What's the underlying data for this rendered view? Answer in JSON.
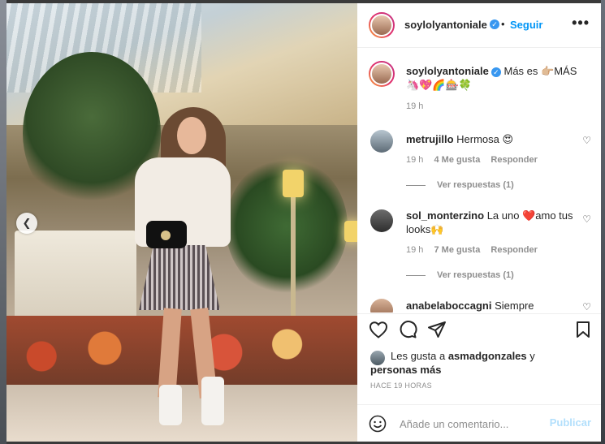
{
  "post": {
    "username": "soylolyantoniale",
    "follow_label": "Seguir",
    "more_icon": "more-options-icon",
    "caption_text": "Más es 👉🏼MÁS",
    "caption_emojis": "🦄💖🌈🎰🍀",
    "caption_time": "19 h"
  },
  "comments": [
    {
      "username": "metrujillo",
      "text": "Hermosa 😍",
      "time": "19 h",
      "likes": "4 Me gusta",
      "reply": "Responder",
      "view_replies": "Ver respuestas (1)"
    },
    {
      "username": "sol_monterzino",
      "text": "La uno ❤️amo tus looks🙌",
      "time": "19 h",
      "likes": "7 Me gusta",
      "reply": "Responder",
      "view_replies": "Ver respuestas (1)"
    },
    {
      "username": "anabelaboccagni",
      "text": "Siempre"
    }
  ],
  "likes": {
    "prefix": "Les gusta a ",
    "user": "asmadgonzales",
    "suffix": " y",
    "others": "personas más"
  },
  "time_ago": "HACE 19 HORAS",
  "add_comment": {
    "placeholder": "Añade un comentario...",
    "publish_label": "Publicar"
  },
  "colors": {
    "accent": "#0095f6",
    "verified": "#3897f0",
    "heart_red": "#ed4956",
    "muted": "#8e8e8e",
    "publish_disabled": "#b2dffc"
  }
}
